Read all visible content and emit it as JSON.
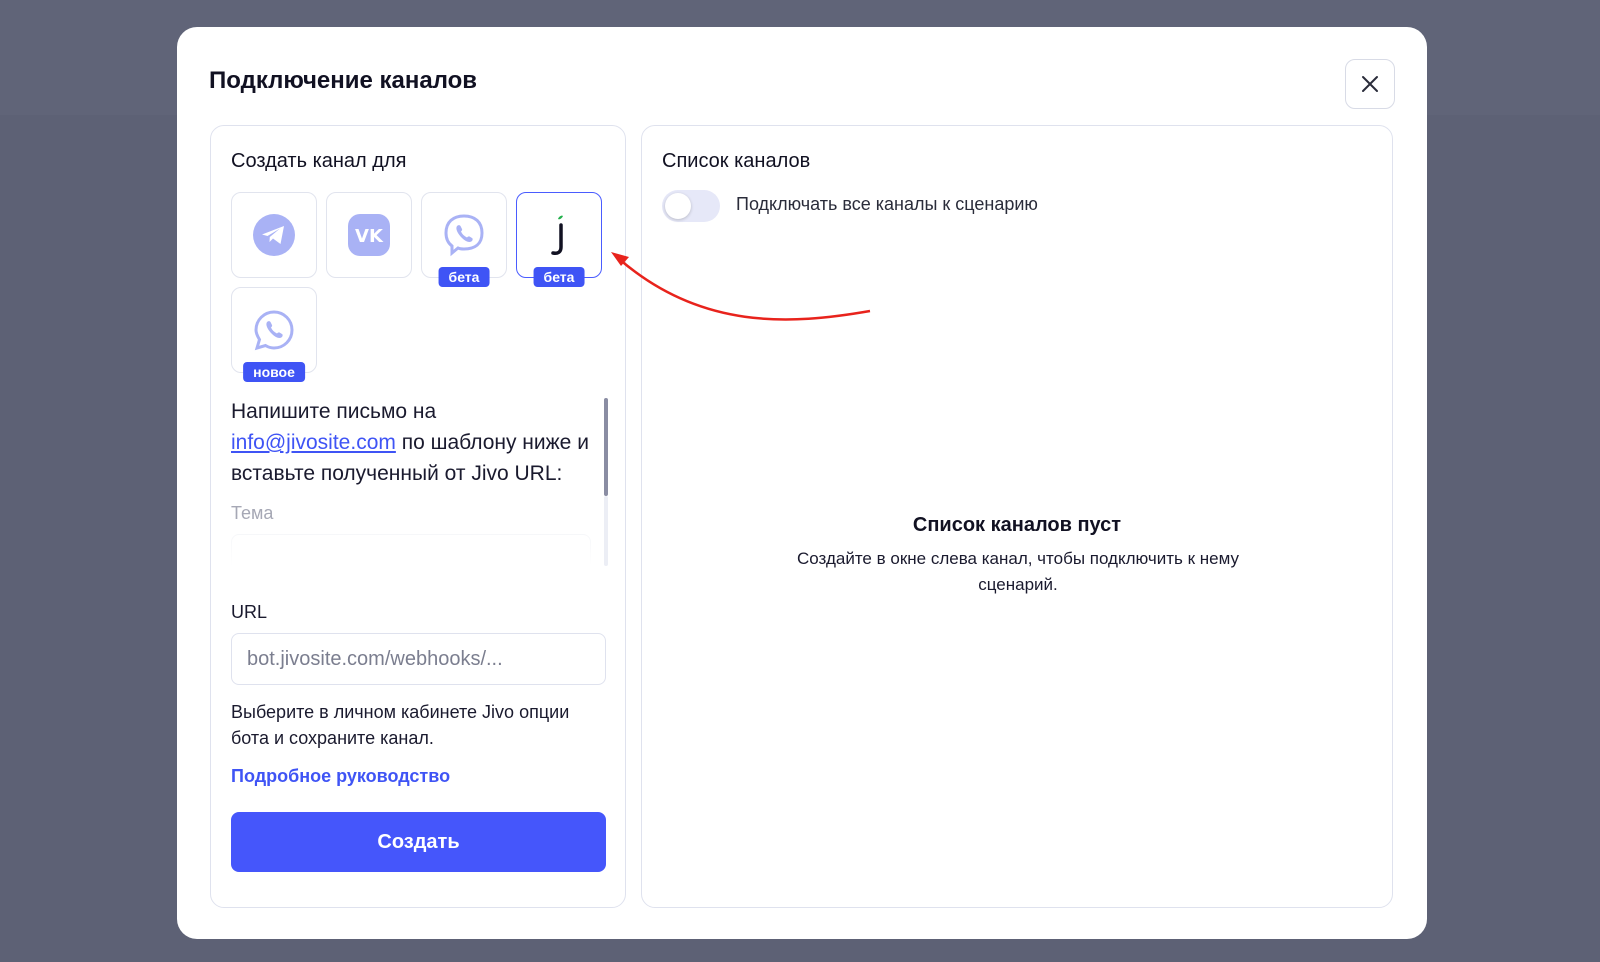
{
  "modal": {
    "title": "Подключение каналов"
  },
  "left_panel": {
    "heading": "Создать канал для",
    "channels": [
      {
        "name": "telegram",
        "icon": "telegram-icon",
        "badge": null
      },
      {
        "name": "vk",
        "icon": "vk-icon",
        "badge": null
      },
      {
        "name": "viber",
        "icon": "viber-icon",
        "badge": "бета"
      },
      {
        "name": "jivo",
        "icon": "jivo-icon",
        "badge": "бета",
        "selected": true
      },
      {
        "name": "whatsapp",
        "icon": "whatsapp-icon",
        "badge": "новое"
      }
    ],
    "instructions_before": "Напишите письмо на ",
    "instructions_email": "info@jivosite.com",
    "instructions_after": " по шаблону ниже и вставьте полученный от Jivo URL:",
    "theme_label": "Тема",
    "url_label": "URL",
    "url_placeholder": "bot.jivosite.com/webhooks/...",
    "url_value": "",
    "hint": "Выберите в личном кабинете Jivo опции бота и сохраните канал.",
    "guide_link": "Подробное руководство",
    "create_button": "Создать"
  },
  "right_panel": {
    "heading": "Список каналов",
    "toggle_label": "Подключать все каналы к сценарию",
    "toggle_on": false,
    "empty_title": "Список каналов пуст",
    "empty_desc": "Создайте в окне слева канал, чтобы подключить к нему сценарий."
  },
  "colors": {
    "accent": "#4556fb",
    "icon_fill": "#a9b2f5",
    "annotation_arrow": "#e8231c",
    "backdrop": "#5d6175"
  }
}
